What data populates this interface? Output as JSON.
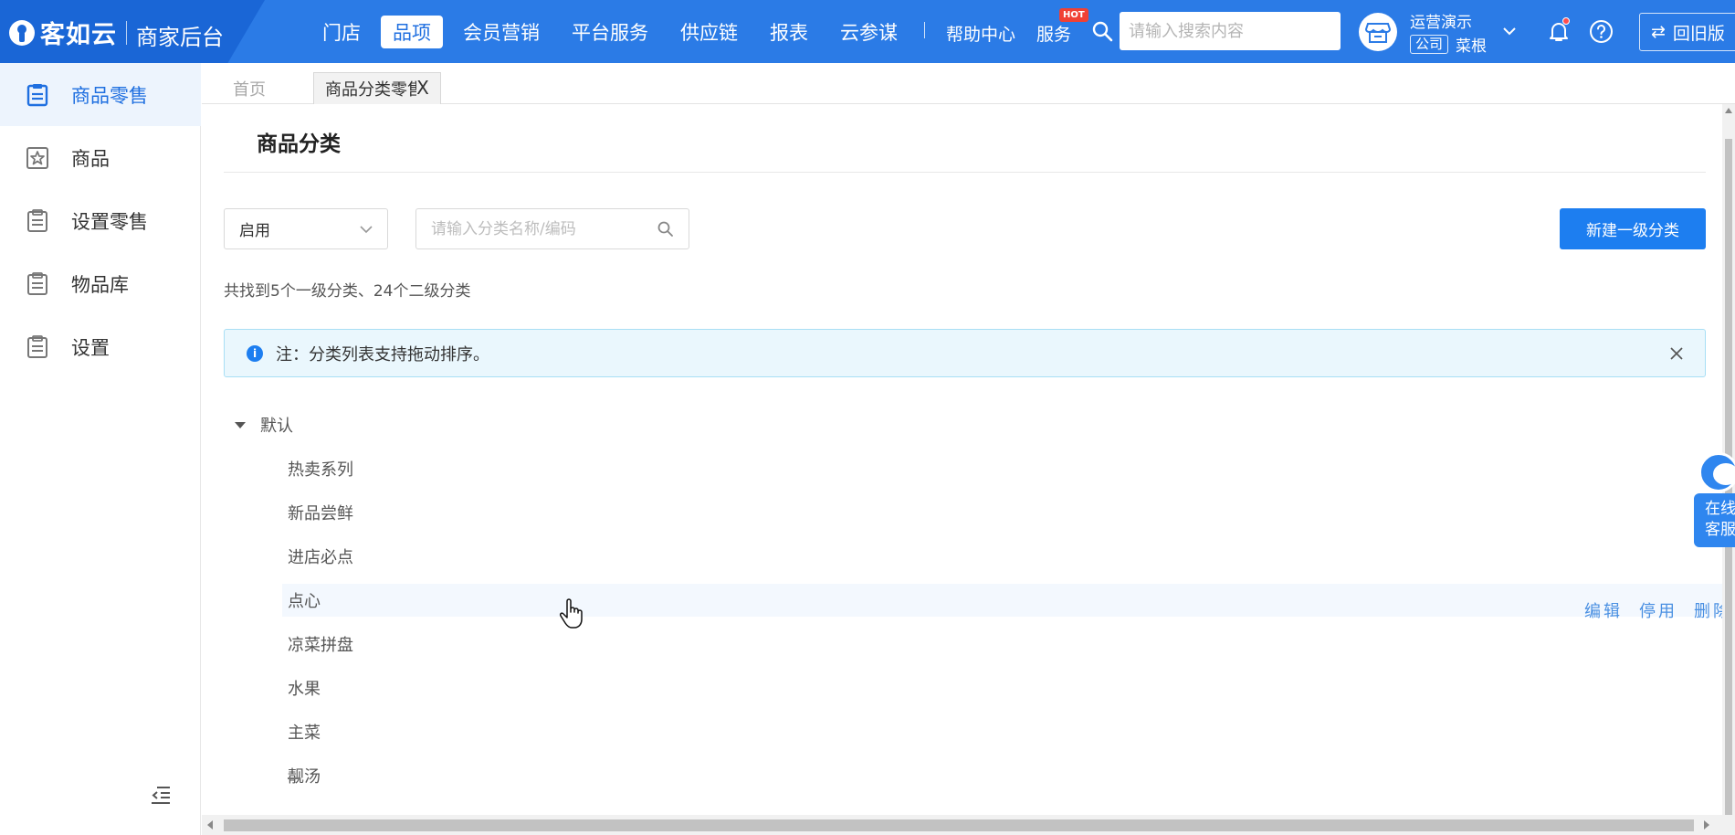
{
  "header": {
    "brand": "客如云",
    "subtitle": "商家后台",
    "nav": [
      {
        "label": "门店",
        "active": false
      },
      {
        "label": "品项",
        "active": true
      },
      {
        "label": "会员营销",
        "active": false
      },
      {
        "label": "平台服务",
        "active": false
      },
      {
        "label": "供应链",
        "active": false
      },
      {
        "label": "报表",
        "active": false
      },
      {
        "label": "云参谋",
        "active": false
      }
    ],
    "separator": "|",
    "help_center": "帮助中心",
    "service": "服务",
    "service_badge": "HOT",
    "search_placeholder": "请输入搜索内容",
    "account_name": "运营演示",
    "account_tag": "公司",
    "account_store": "菜根",
    "old_version_icon": "⇄",
    "old_version": "回旧版",
    "accent_color": "#2b7be6"
  },
  "sidebar": {
    "items": [
      {
        "label": "商品零售",
        "icon": "clipboard-icon",
        "active": true
      },
      {
        "label": "商品",
        "icon": "star-box-icon",
        "active": false
      },
      {
        "label": "设置零售",
        "icon": "clipboard-icon",
        "active": false
      },
      {
        "label": "物品库",
        "icon": "clipboard-icon",
        "active": false
      },
      {
        "label": "设置",
        "icon": "clipboard-icon",
        "active": false
      }
    ],
    "collapse_icon": "collapse-menu-icon"
  },
  "tabs": {
    "home": "首页",
    "current": "商品分类零售",
    "close": "X"
  },
  "page": {
    "title": "商品分类",
    "status_value": "启用",
    "search_placeholder": "请输入分类名称/编码",
    "new_button": "新建一级分类",
    "summary": "共找到5个一级分类、24个二级分类",
    "notice": "注：分类列表支持拖动排序。",
    "tree": {
      "root": "默认",
      "children": [
        "热卖系列",
        "新品尝鲜",
        "进店必点",
        "点心",
        "凉菜拼盘",
        "水果",
        "主菜",
        "靓汤"
      ]
    },
    "hovered_index": 3,
    "row_actions": [
      "编辑",
      "停用",
      "删除"
    ]
  },
  "widget": {
    "line1": "在线",
    "line2": "客服"
  }
}
